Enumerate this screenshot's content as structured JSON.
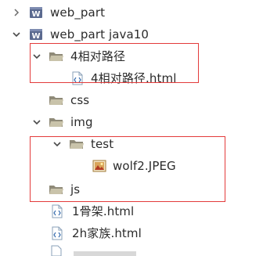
{
  "tree": {
    "items": [
      {
        "label": "web_part",
        "icon": "java-project-icon",
        "twisty": "collapsed"
      },
      {
        "label": "web_part java10",
        "icon": "java-project-icon",
        "twisty": "expanded"
      },
      {
        "label": "4相对路径",
        "icon": "folder-open-icon",
        "twisty": "expanded"
      },
      {
        "label": "4相对路径.html",
        "icon": "html-file-icon",
        "twisty": "none"
      },
      {
        "label": "css",
        "icon": "folder-open-icon",
        "twisty": "none"
      },
      {
        "label": "img",
        "icon": "folder-open-icon",
        "twisty": "expanded"
      },
      {
        "label": "test",
        "icon": "folder-open-icon",
        "twisty": "expanded"
      },
      {
        "label": "wolf2.JPEG",
        "icon": "image-file-icon",
        "twisty": "none"
      },
      {
        "label": "js",
        "icon": "folder-open-icon",
        "twisty": "none"
      },
      {
        "label": "1骨架.html",
        "icon": "html-file-icon",
        "twisty": "none"
      },
      {
        "label": "2h家族.html",
        "icon": "html-file-icon",
        "twisty": "none"
      }
    ]
  },
  "colors": {
    "highlight_box": "#e33b3b",
    "text": "#2b2b2b",
    "twisty": "#6a6a6a",
    "folder": "#b3ad96",
    "project": "#5b6a8f"
  }
}
